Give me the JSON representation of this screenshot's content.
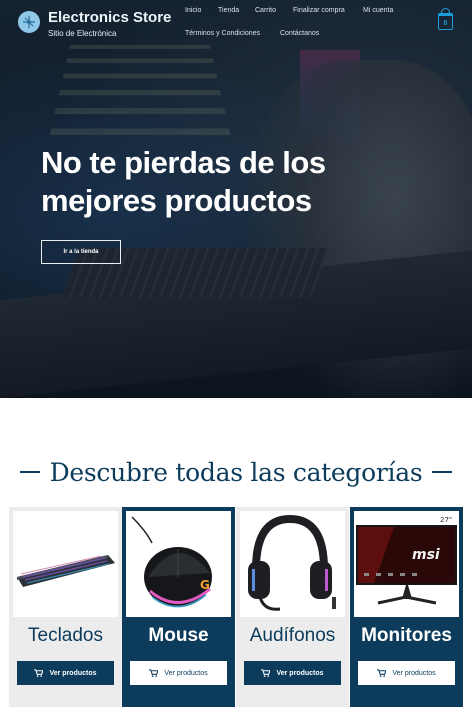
{
  "header": {
    "site_title": "Electronics Store",
    "site_description": "Sitio de Electrónica",
    "nav": [
      "Inicio",
      "Tienda",
      "Carrito",
      "Finalizar compra",
      "Mi cuenta",
      "Términos y Condiciones",
      "Contáctanos"
    ],
    "cart_count": "0"
  },
  "hero": {
    "title": "No te pierdas de los mejores productos",
    "button_label": "Ir a la tienda"
  },
  "categories": {
    "heading": "Descubre todas las categorías",
    "items": [
      {
        "name": "Teclados",
        "button": "Ver productos",
        "style": "light"
      },
      {
        "name": "Mouse",
        "button": "Ver productos",
        "style": "dark"
      },
      {
        "name": "Audífonos",
        "button": "Ver productos",
        "style": "light"
      },
      {
        "name": "Monitores",
        "button": "Ver productos",
        "style": "dark"
      }
    ],
    "monitor_brand_text": "msi",
    "monitor_size_text": "27\""
  },
  "colors": {
    "primary": "#0c3b5b",
    "accent": "#1a9fd8",
    "card_light": "#ececec"
  },
  "icons": [
    "site-logo-icon",
    "cart-icon",
    "shopping-cart-icon"
  ]
}
